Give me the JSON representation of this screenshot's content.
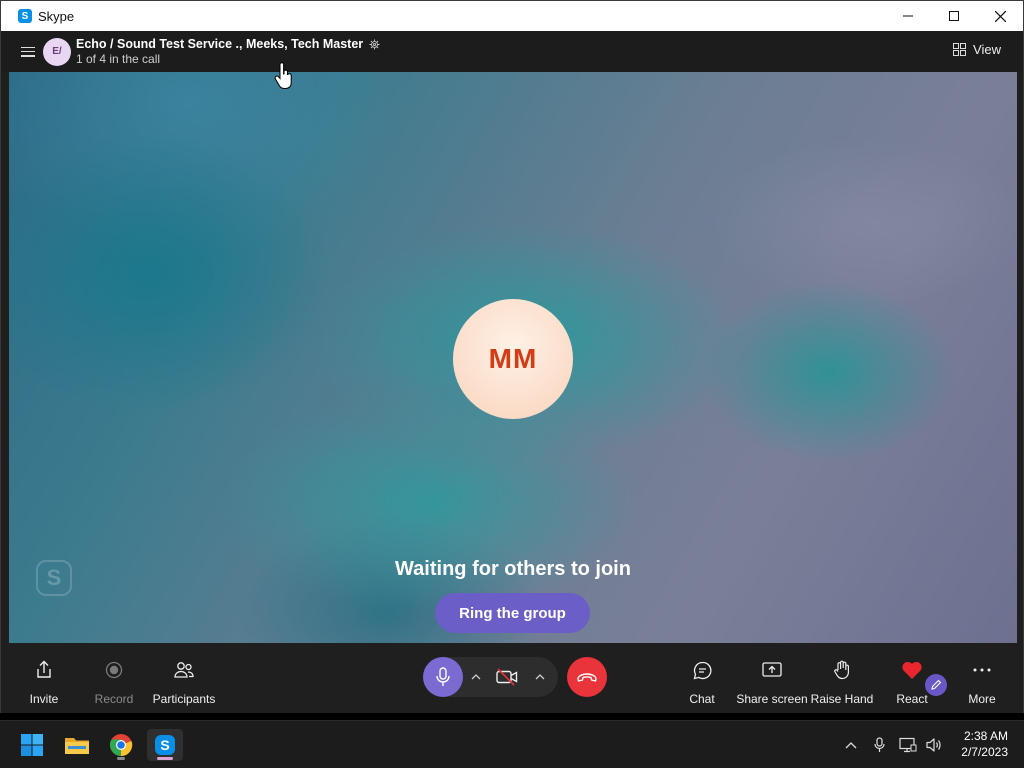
{
  "window": {
    "app_title": "Skype",
    "app_icon_letter": "S",
    "controls": [
      "minimize",
      "maximize",
      "close"
    ]
  },
  "call_header": {
    "avatar_initials": "E/",
    "title": "Echo / Sound Test Service ., Meeks, Tech Master",
    "subtitle": "1 of 4 in the call",
    "view_label": "View"
  },
  "stage": {
    "participant_initials": "MM",
    "waiting_text": "Waiting for others to join",
    "ring_button_label": "Ring the group",
    "watermark_letter": "S"
  },
  "controls": {
    "invite": "Invite",
    "record": "Record",
    "participants": "Participants",
    "chat": "Chat",
    "share_screen": "Share screen",
    "raise_hand": "Raise Hand",
    "react": "React",
    "more": "More"
  },
  "colors": {
    "accent": "#7b6ad2",
    "end_call": "#e8343a",
    "avatar_text": "#d23d16"
  },
  "taskbar": {
    "time": "2:38 AM",
    "date": "2/7/2023",
    "apps": [
      "windows-start",
      "file-explorer",
      "chrome",
      "skype"
    ]
  }
}
